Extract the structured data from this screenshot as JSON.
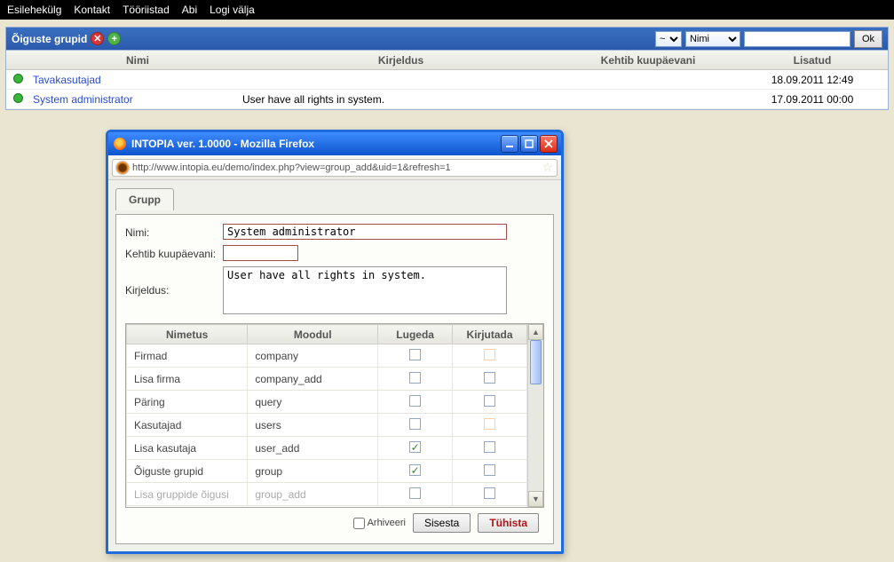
{
  "menu": {
    "home": "Esilehekülg",
    "contact": "Kontakt",
    "tools": "Tööriistad",
    "help": "Abi",
    "logout": "Logi välja"
  },
  "panel": {
    "title": "Õiguste grupid",
    "tilde_value": "~",
    "filter_field": "Nimi",
    "search_value": "",
    "ok": "Ok",
    "columns": {
      "name": "Nimi",
      "desc": "Kirjeldus",
      "valid": "Kehtib kuupäevani",
      "added": "Lisatud"
    },
    "rows": [
      {
        "name": "Tavakasutajad",
        "desc": "",
        "valid": "",
        "added": "18.09.2011 12:49"
      },
      {
        "name": "System administrator",
        "desc": "User have all rights in system.",
        "valid": "",
        "added": "17.09.2011 00:00"
      }
    ]
  },
  "popup": {
    "title": "INTOPIA ver. 1.0000 - Mozilla Firefox",
    "url": "http://www.intopia.eu/demo/index.php?view=group_add&uid=1&refresh=1",
    "tab": "Grupp",
    "labels": {
      "nimi": "Nimi:",
      "kehtib": "Kehtib kuupäevani:",
      "kirjeldus": "Kirjeldus:"
    },
    "form": {
      "nimi": "System administrator",
      "kehtib": "",
      "kirjeldus": "User have all rights in system."
    },
    "perm_cols": {
      "nimetus": "Nimetus",
      "moodul": "Moodul",
      "lugeda": "Lugeda",
      "kirjutada": "Kirjutada"
    },
    "permissions": [
      {
        "name": "Firmad",
        "module": "company",
        "read": false,
        "write_faint": true
      },
      {
        "name": "Lisa firma",
        "module": "company_add",
        "read": false,
        "write": false
      },
      {
        "name": "Päring",
        "module": "query",
        "read": false,
        "write": false
      },
      {
        "name": "Kasutajad",
        "module": "users",
        "read": false,
        "write_faint": true
      },
      {
        "name": "Lisa kasutaja",
        "module": "user_add",
        "read": true,
        "write": false
      },
      {
        "name": "Õiguste grupid",
        "module": "group",
        "read": true,
        "write": false
      },
      {
        "name": "Lisa gruppide õigusi",
        "module": "group_add",
        "read": false,
        "write": false,
        "cut": true
      }
    ],
    "footer": {
      "archive": "Arhiveeri",
      "insert": "Sisesta",
      "cancel": "Tühista"
    }
  }
}
